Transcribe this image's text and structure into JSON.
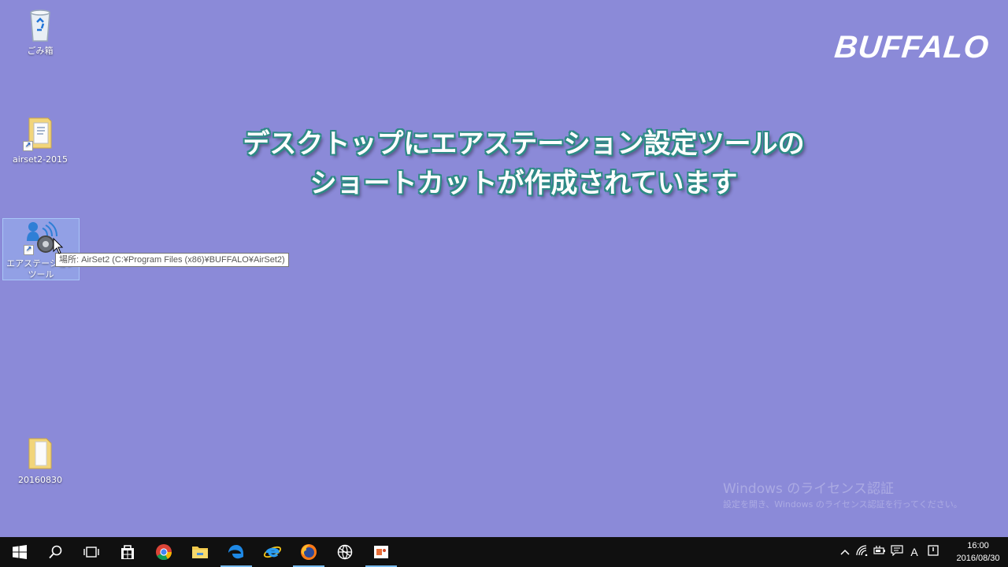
{
  "desktop": {
    "icons": [
      {
        "label": "ごみ箱"
      },
      {
        "label": "airset2-2015"
      },
      {
        "label_line1": "エアステーション",
        "label_line2": "ツール"
      },
      {
        "label": "20160830"
      }
    ],
    "tooltip": "場所: AirSet2 (C:¥Program Files (x86)¥BUFFALO¥AirSet2)"
  },
  "overlay": {
    "brand": "BUFFALO",
    "caption_line1": "デスクトップにエアステーション設定ツールの",
    "caption_line2": "ショートカットが作成されています"
  },
  "watermark": {
    "line1": "Windows のライセンス認証",
    "line2": "設定を開き、Windows のライセンス認証を行ってください。"
  },
  "taskbar": {
    "icons": [
      "windows-start-icon",
      "search-icon",
      "task-view-icon",
      "store-icon",
      "chrome-icon",
      "file-explorer-icon",
      "edge-icon",
      "internet-explorer-icon",
      "firefox-icon",
      "network-globe-icon",
      "office-icon"
    ],
    "tray": {
      "ime": "A"
    },
    "clock": {
      "time": "16:00",
      "date": "2016/08/30"
    }
  }
}
